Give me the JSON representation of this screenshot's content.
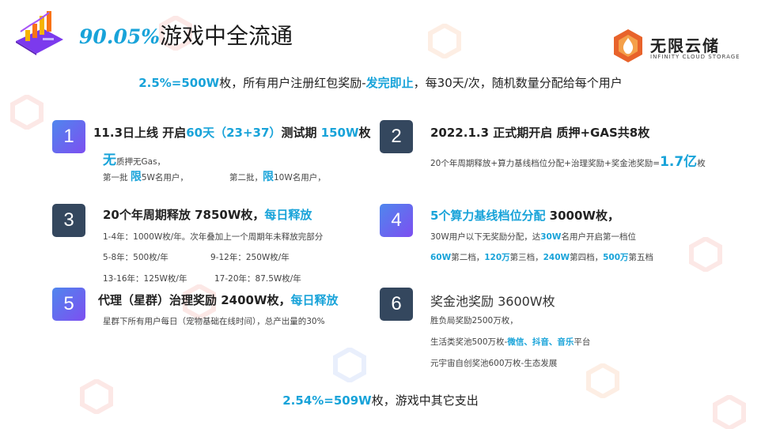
{
  "header": {
    "title_highlight": "90.05%",
    "title_rest": "游戏中全流通"
  },
  "brand": {
    "name": "无限云储",
    "sub": "INFINITY CLOUD STORAGE"
  },
  "subtitle": {
    "hl1": "2.5%=500W",
    "t1": "枚，所有用户注册红包奖励-",
    "hl2": "发完即止",
    "t2": "，每30天/次，随机数量分配给每个用户"
  },
  "items": [
    {
      "num": "1",
      "heading": {
        "a": "11.3日上线 开启",
        "b": "60天（23+37）",
        "c": "测试期  ",
        "d": "150W",
        "e": "枚"
      },
      "l1": {
        "big": "无",
        "rest": "质押无Gas，"
      },
      "l2": {
        "a": "第一批  ",
        "b": "限",
        "c": "5W名用户，",
        "d": "第二批，",
        "e": "限",
        "f": "10W名用户，"
      }
    },
    {
      "num": "2",
      "heading": "2022.1.3   正式期开启   质押+GAS共8枚",
      "l1": {
        "a": "20个年周期释放+算力基线档位分配+治理奖励+奖金池奖励=",
        "b": "1.7亿",
        "c": "枚"
      }
    },
    {
      "num": "3",
      "heading": {
        "a": "20个年周期释放    7850W枚，",
        "b": "每日释放"
      },
      "l1": "1-4年：1000W枚/年。次年叠加上一个周期年未释放完部分",
      "l2a": "5-8年：500枚/年",
      "l2b": "9-12年：250W枚/年",
      "l3a": "13-16年：125W枚/年",
      "l3b": "17-20年：87.5W枚/年"
    },
    {
      "num": "4",
      "heading": {
        "a": "5个算力基线档位分配",
        "b": "      3000W枚，"
      },
      "l1": {
        "a": "30W用户以下无奖励分配，达",
        "b": "30W",
        "c": "名用户开启第一档位"
      },
      "l2": {
        "a": "60W",
        "b": "第二档，",
        "c": "120万",
        "d": "第三档，",
        "e": "240W",
        "f": "第四档，",
        "g": "500万",
        "h": "第五档"
      }
    },
    {
      "num": "5",
      "heading": {
        "a": "代理（星群）治理奖励 2400W枚，",
        "b": "每日释放"
      },
      "l1": "星群下所有用户每日（宠物基础在线时间），总产出量的30%"
    },
    {
      "num": "6",
      "heading": "奖金池奖励   3600W枚",
      "l1": "胜负局奖励2500万枚，",
      "l2": {
        "a": "生活类奖池500万枚-",
        "b": "微信、抖音、音乐",
        "c": "平台"
      },
      "l3": "元宇宙自创奖池600万枚-生态发展"
    }
  ],
  "footer": {
    "hl": "2.54%=509W",
    "rest": "枚，游戏中其它支出"
  },
  "colors": {
    "accent": "#18a3d9",
    "badge_dark": "#34475e",
    "badge_grad_start": "#4f86ee",
    "badge_grad_end": "#7d4ff0"
  }
}
